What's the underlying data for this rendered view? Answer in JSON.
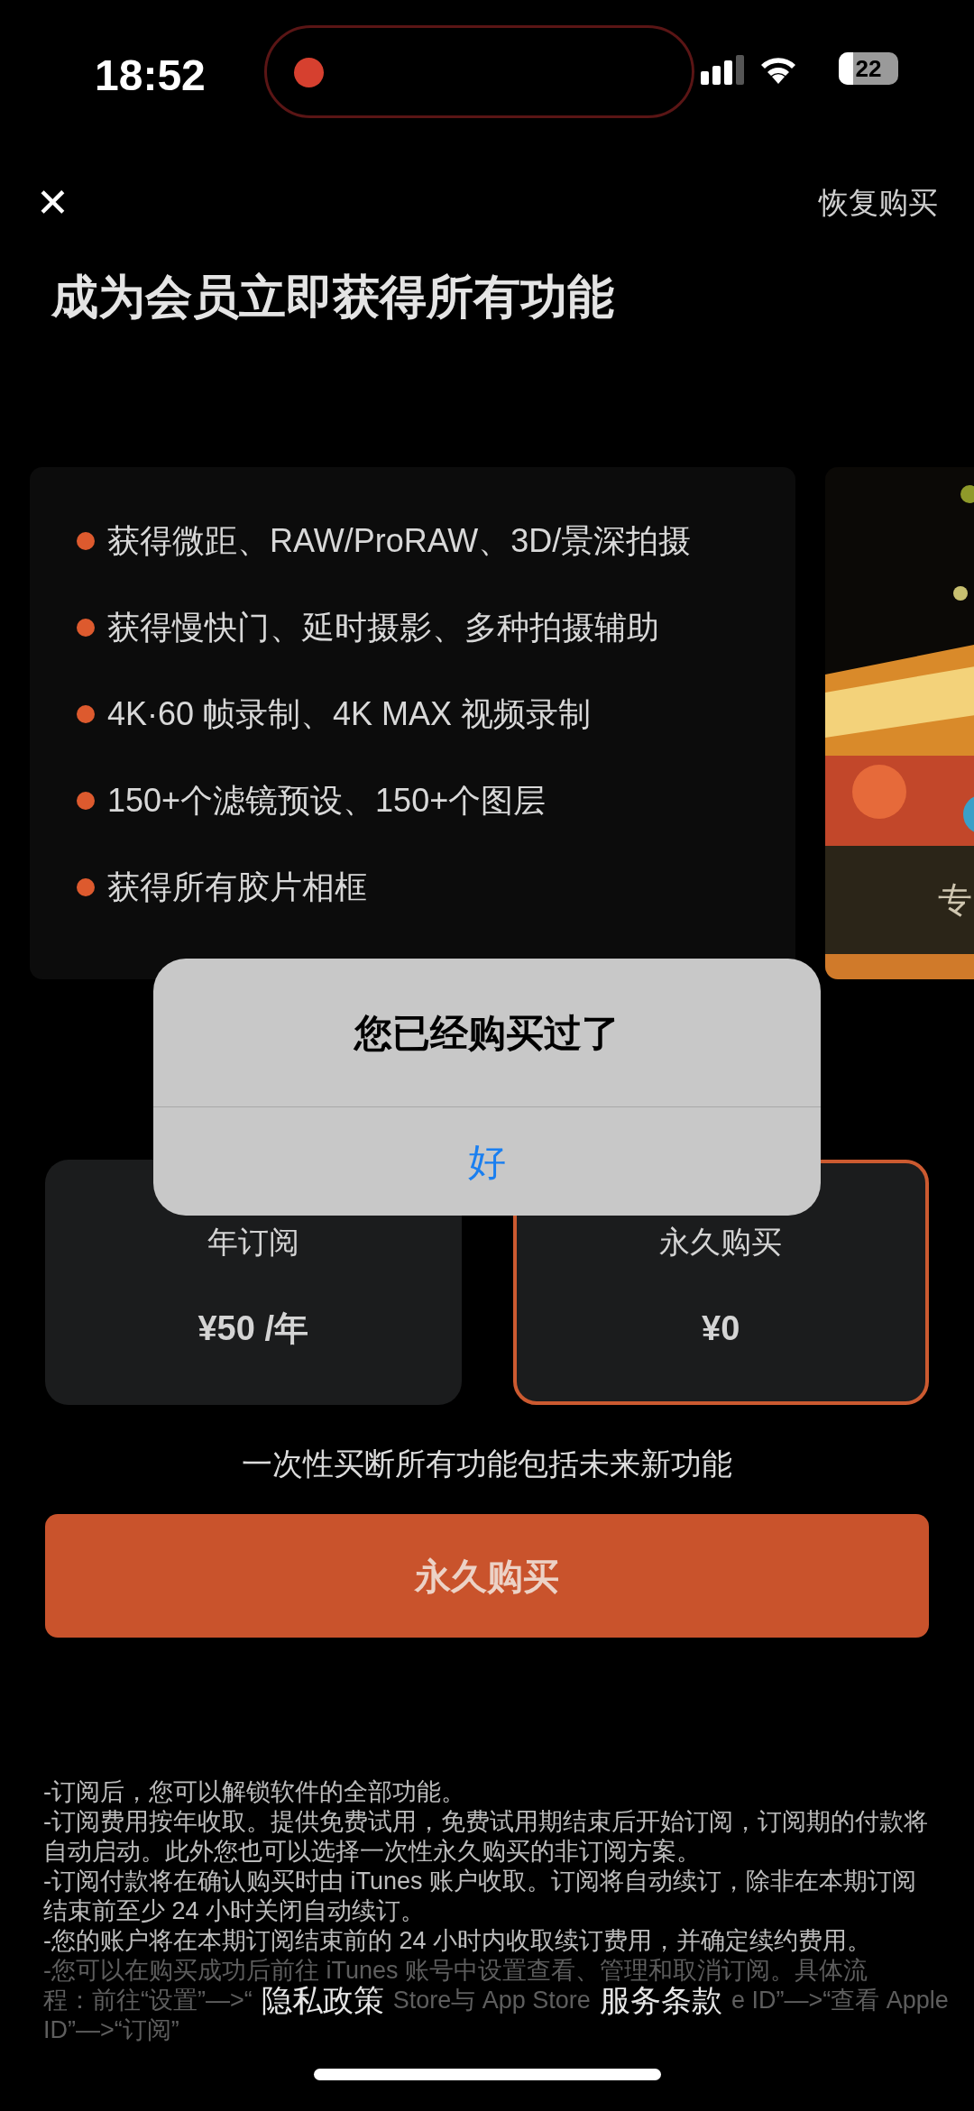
{
  "status_bar": {
    "time": "18:52",
    "recording": true,
    "battery": "22"
  },
  "header": {
    "close": "✕",
    "restore": "恢复购买"
  },
  "title": "成为会员立即获得所有功能",
  "features": [
    "获得微距、RAW/ProRAW、3D/景深拍摄",
    "获得慢快门、延时摄影、多种拍摄辅助",
    "4K·60 帧录制、4K MAX 视频录制",
    "150+个滤镜预设、150+个图层",
    "获得所有胶片相框"
  ],
  "promo_card": {
    "kind": "picture",
    "caption": "专"
  },
  "plans": [
    {
      "name": "年订阅",
      "price": "¥50 /年",
      "selected": false
    },
    {
      "name": "永久购买",
      "price": "¥0",
      "selected": true
    }
  ],
  "plan_note": "一次性买断所有功能包括未来新功能",
  "buy_button": "永久购买",
  "terms": [
    "-订阅后，您可以解锁软件的全部功能。",
    "-订阅费用按年收取。提供免费试用，免费试用期结束后开始订阅，订阅期的付款将自动启动。此外您也可以选择一次性永久购买的非订阅方案。",
    "-订阅付款将在确认购买时由 iTunes 账户收取。订阅将自动续订，除非在本期订阅结束前至少 24 小时关闭自动续订。",
    "-您的账户将在本期订阅结束前的 24 小时内收取续订费用，并确定续约费用。"
  ],
  "faded_terms": {
    "line_1": "-您可以在购买成功后前往 iTunes 账号中设置查看、管理和取消订阅。具体流",
    "line_2_parts": [
      "程：前往“设置”—>“",
      "Store与 App Store",
      "e ID”—>“查看 Apple"
    ],
    "line_3": "ID”—>“订阅”"
  },
  "links": [
    "隐私政策",
    "服务条款"
  ],
  "alert": {
    "title": "您已经购买过了",
    "button": "好"
  }
}
